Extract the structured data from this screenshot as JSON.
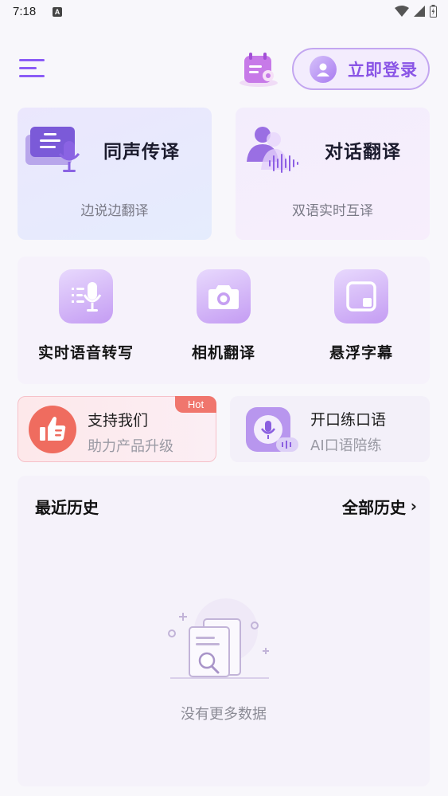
{
  "status_bar": {
    "time": "7:18",
    "notif_letter": "A"
  },
  "header": {
    "login_label": "立即登录"
  },
  "features": [
    {
      "title": "同声传译",
      "subtitle": "边说边翻译"
    },
    {
      "title": "对话翻译",
      "subtitle": "双语实时互译"
    }
  ],
  "tools": [
    {
      "label": "实时语音转写",
      "icon": "transcribe-mic-icon"
    },
    {
      "label": "相机翻译",
      "icon": "camera-icon"
    },
    {
      "label": "悬浮字幕",
      "icon": "floating-subtitle-icon"
    }
  ],
  "promos": [
    {
      "title": "支持我们",
      "subtitle": "助力产品升级",
      "badge": "Hot",
      "icon": "thumbs-up-icon"
    },
    {
      "title": "开口练口语",
      "subtitle": "AI口语陪练",
      "icon": "speech-practice-icon"
    }
  ],
  "history": {
    "title": "最近历史",
    "all_label": "全部历史",
    "empty_text": "没有更多数据"
  },
  "colors": {
    "accent": "#8b5cf6",
    "hot_badge": "#f0766d"
  }
}
